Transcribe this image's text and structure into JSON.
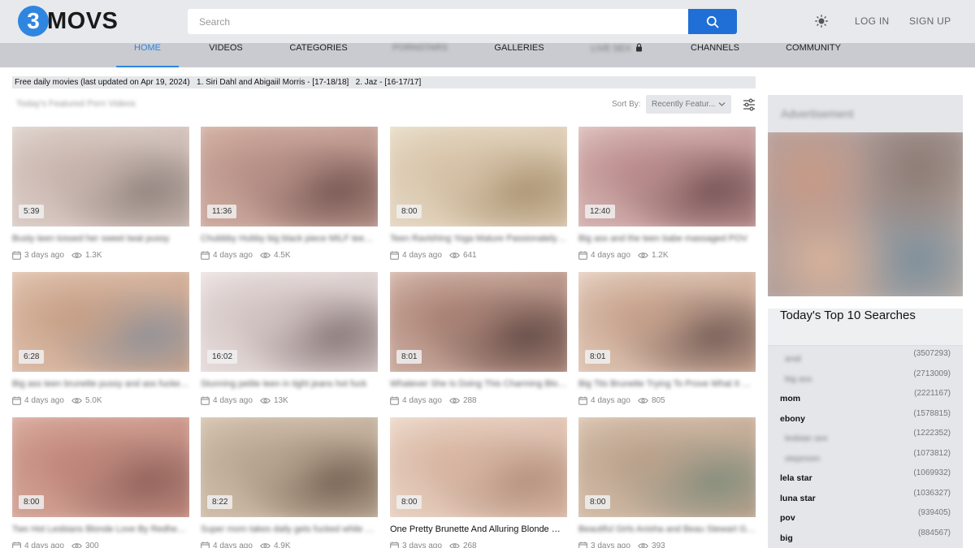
{
  "header": {
    "logo_digit": "3",
    "logo_text": "MOVS",
    "search_placeholder": "Search",
    "login_label": "LOG IN",
    "signup_label": "SIGN UP",
    "accent_color": "#1f6fd6"
  },
  "nav": {
    "items": [
      {
        "label": "HOME",
        "active": true
      },
      {
        "label": "VIDEOS"
      },
      {
        "label": "CATEGORIES"
      },
      {
        "label": "PORNSTARS",
        "blurred": true
      },
      {
        "label": "GALLERIES"
      },
      {
        "label": "LIVE SEX",
        "blurred": true
      },
      {
        "label": "CHANNELS"
      },
      {
        "label": "COMMUNITY"
      }
    ]
  },
  "ticker": {
    "text": "Free daily movies (last updated on Apr 19, 2024)   1. Siri Dahl and Abigaiil Morris - [17-18/18]   2. Jaz - [16-17/17]"
  },
  "toolbar": {
    "section_title": "Today's Featured Porn Videos",
    "sort_label": "Sort By:",
    "sort_value": "Recently Featur..."
  },
  "videos": [
    {
      "duration": "5:39",
      "title": "Busty teen tossed her sweet twat pussy",
      "age": "3 days ago",
      "views": "1.3K",
      "blurred_title": true
    },
    {
      "duration": "11:36",
      "title": "Chubbby Hubby big black piece MILF teen ...",
      "age": "4 days ago",
      "views": "4.5K",
      "blurred_title": true
    },
    {
      "duration": "8:00",
      "title": "Teen Ravishing Yoga Mature Passionately ho ...",
      "age": "4 days ago",
      "views": "641",
      "blurred_title": true
    },
    {
      "duration": "12:40",
      "title": "Big ass and the teen babe massaged POV",
      "age": "4 days ago",
      "views": "1.2K",
      "blurred_title": true
    },
    {
      "duration": "6:28",
      "title": "Big ass teen brunette pussy and ass fucked ...",
      "age": "4 days ago",
      "views": "5.0K",
      "blurred_title": true
    },
    {
      "duration": "16:02",
      "title": "Stunning petite teen in tight jeans hot fuck",
      "age": "4 days ago",
      "views": "13K",
      "blurred_title": true
    },
    {
      "duration": "8:01",
      "title": "Whatever She Is Doing This Charming Blon ...",
      "age": "4 days ago",
      "views": "288",
      "blurred_title": true
    },
    {
      "duration": "8:01",
      "title": "Big Tits Brunette Trying To Prove What It Re ...",
      "age": "4 days ago",
      "views": "805",
      "blurred_title": true
    },
    {
      "duration": "8:00",
      "title": "Two Hot Lesbians Blonde Love By Redhead ...",
      "age": "4 days ago",
      "views": "300",
      "blurred_title": true
    },
    {
      "duration": "8:22",
      "title": "Super mom takes daily gets fucked while m ...",
      "age": "4 days ago",
      "views": "4.9K",
      "blurred_title": true
    },
    {
      "duration": "8:00",
      "title": "One Pretty Brunette And Alluring Blonde Go ...",
      "age": "3 days ago",
      "views": "268",
      "blurred_title": false
    },
    {
      "duration": "8:00",
      "title": "Beautiful Girls Anisha and Beau Stewart G ...",
      "age": "3 days ago",
      "views": "393",
      "blurred_title": true
    }
  ],
  "sidebar": {
    "ad_title": "Advertisement",
    "top_searches_title": "Today's Top 10 Searches",
    "top_searches": [
      {
        "term": "anal",
        "count": "(3507293)",
        "blurred": true
      },
      {
        "term": "big ass",
        "count": "(2713009)",
        "blurred": true
      },
      {
        "term": "mom",
        "count": "(2221167)",
        "blurred": false
      },
      {
        "term": "ebony",
        "count": "(1578815)",
        "blurred": false
      },
      {
        "term": "lesbian sex",
        "count": "(1222352)",
        "blurred": true
      },
      {
        "term": "stepmom",
        "count": "(1073812)",
        "blurred": true
      },
      {
        "term": "lela star",
        "count": "(1069932)",
        "blurred": false
      },
      {
        "term": "luna star",
        "count": "(1036327)",
        "blurred": false
      },
      {
        "term": "pov",
        "count": "(939405)",
        "blurred": false
      },
      {
        "term": "big",
        "count": "(884567)",
        "blurred": false
      }
    ]
  }
}
